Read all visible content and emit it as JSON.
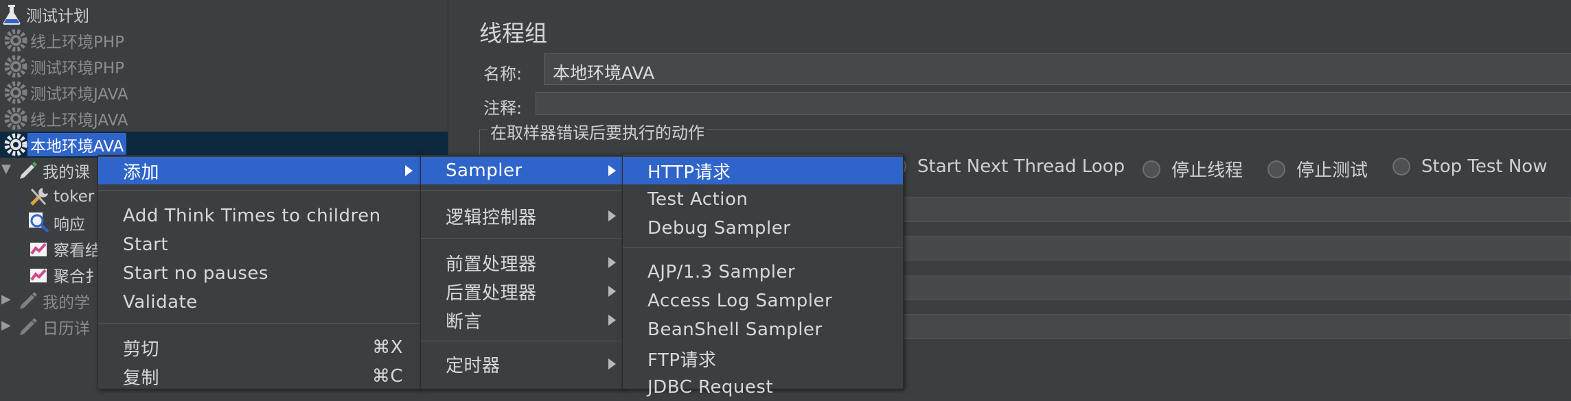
{
  "tree": {
    "items": [
      {
        "label": "测试计划",
        "icon": "flask-icon"
      },
      {
        "label": "线上环境PHP",
        "icon": "gear-icon"
      },
      {
        "label": "测试环境PHP",
        "icon": "gear-icon"
      },
      {
        "label": "测试环境JAVA",
        "icon": "gear-icon"
      },
      {
        "label": "线上环境JAVA",
        "icon": "gear-icon"
      },
      {
        "label": "本地环境AVA",
        "icon": "gear-icon"
      },
      {
        "label": "我的课",
        "icon": "pipette-icon"
      },
      {
        "label": "toker",
        "icon": "wrench-icon"
      },
      {
        "label": "响应",
        "icon": "magnifier-icon"
      },
      {
        "label": "察看结",
        "icon": "chart-icon"
      },
      {
        "label": "聚合扌",
        "icon": "chart-icon"
      },
      {
        "label": "我的学",
        "icon": "pipette-icon"
      },
      {
        "label": "日历详",
        "icon": "pipette-icon"
      }
    ]
  },
  "panel": {
    "title": "线程组",
    "name_label": "名称:",
    "name_value": "本地环境AVA",
    "comment_label": "注释:",
    "comment_value": "",
    "error_group_title": "在取样器错误后要执行的动作",
    "error_options": [
      "Start Next Thread Loop",
      "停止线程",
      "停止测试",
      "Stop Test Now"
    ]
  },
  "menu_main": {
    "items": [
      {
        "label": "添加",
        "submenu": true
      },
      {
        "label": "Add Think Times to children"
      },
      {
        "label": "Start"
      },
      {
        "label": "Start no pauses"
      },
      {
        "label": "Validate"
      },
      {
        "label": "剪切",
        "shortcut": "⌘X"
      },
      {
        "label": "复制",
        "shortcut": "⌘C"
      }
    ]
  },
  "menu_add": {
    "items": [
      {
        "label": "Sampler",
        "submenu": true
      },
      {
        "label": "逻辑控制器",
        "submenu": true
      },
      {
        "label": "前置处理器",
        "submenu": true
      },
      {
        "label": "后置处理器",
        "submenu": true
      },
      {
        "label": "断言",
        "submenu": true
      },
      {
        "label": "定时器",
        "submenu": true
      }
    ]
  },
  "menu_sampler": {
    "items": [
      {
        "label": "HTTP请求"
      },
      {
        "label": "Test Action"
      },
      {
        "label": "Debug Sampler"
      },
      {
        "label": "AJP/1.3 Sampler"
      },
      {
        "label": "Access Log Sampler"
      },
      {
        "label": "BeanShell Sampler"
      },
      {
        "label": "FTP请求"
      },
      {
        "label": "JDBC Request"
      }
    ]
  },
  "colors": {
    "background": "#3c3f41",
    "selection": "#2f65ca",
    "tree_selected_row": "#0d293e"
  }
}
